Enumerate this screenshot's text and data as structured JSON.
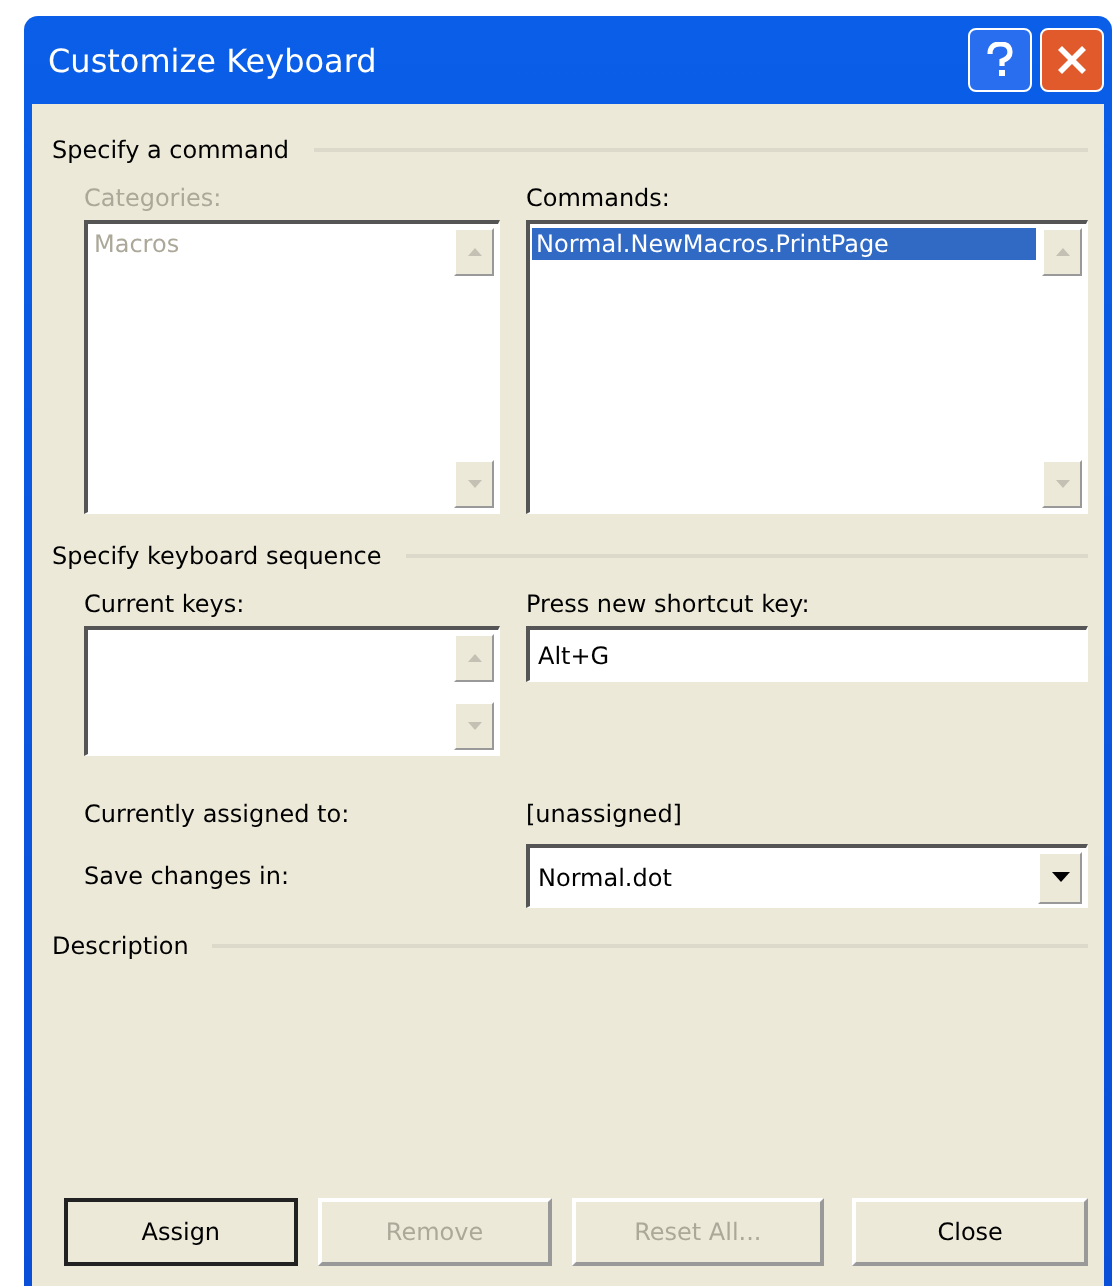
{
  "window": {
    "title": "Customize Keyboard"
  },
  "command_section": {
    "title": "Specify a command",
    "categories": {
      "label": "Categories:",
      "disabled": true,
      "items": [
        {
          "text": "Macros",
          "selected": false
        }
      ]
    },
    "commands": {
      "label": "Commands:",
      "disabled": false,
      "items": [
        {
          "text": "Normal.NewMacros.PrintPage",
          "selected": true
        }
      ]
    }
  },
  "keyboard_section": {
    "title": "Specify keyboard sequence",
    "current_keys": {
      "label": "Current keys:"
    },
    "new_shortcut": {
      "label": "Press new shortcut key:",
      "value": "Alt+G"
    },
    "assigned": {
      "label": "Currently assigned to:",
      "value": "[unassigned]"
    },
    "save_in": {
      "label": "Save changes in:",
      "value": "Normal.dot"
    }
  },
  "description_section": {
    "title": "Description"
  },
  "buttons": [
    {
      "label": "Assign",
      "disabled": false,
      "default": true
    },
    {
      "label": "Remove",
      "disabled": true,
      "default": false
    },
    {
      "label": "Reset All...",
      "disabled": true,
      "default": false
    },
    {
      "label": "Close",
      "disabled": false,
      "default": false
    }
  ]
}
